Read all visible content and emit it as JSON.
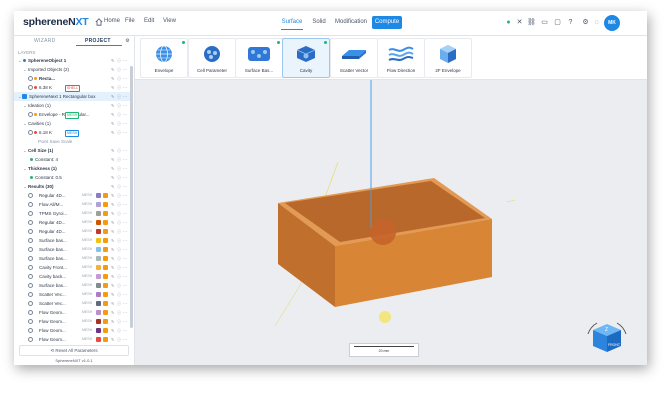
{
  "app": {
    "logo_main": "sphereneN",
    "logo_accent": "XT",
    "menu": [
      "Home",
      "File",
      "Edit",
      "View"
    ],
    "tabs": [
      "Surface",
      "Solid",
      "Modification",
      "Compute"
    ],
    "active_tab": "Compute",
    "avatar": "MK"
  },
  "sidebar": {
    "tabs": [
      "WIZARD",
      "PROJECT"
    ],
    "layers_label": "LAYERS",
    "rows": [
      {
        "indent": 0,
        "label": "SphereneObject 1",
        "color": "#2a7de1",
        "kind": "group",
        "bold": true
      },
      {
        "indent": 1,
        "label": "Imported Objects (2)",
        "kind": "group"
      },
      {
        "indent": 2,
        "label": "Recta...",
        "swatch": "#f39c12",
        "badge": "",
        "bold": true
      },
      {
        "indent": 2,
        "label": "6.38 K",
        "swatch": "#e74c3c",
        "badge": "SHELL",
        "badge_color": "#e74c3c"
      },
      {
        "indent": 0,
        "label": "SphereneNext 1 Rectangular box",
        "kind": "root",
        "highlight": true
      },
      {
        "indent": 1,
        "label": "Ideation (1)",
        "kind": "group"
      },
      {
        "indent": 2,
        "label": "Envelope - Rectangular...",
        "swatch": "#f39c12",
        "badge": "MESH",
        "badge_color": "#22b573"
      },
      {
        "indent": 1,
        "label": "Cavities (1)",
        "kind": "group"
      },
      {
        "indent": 2,
        "label": "6.18 K",
        "swatch": "#e74c3c",
        "badge": "MESH",
        "badge_color": "#1e88e5"
      },
      {
        "indent": 3,
        "label": "Point Save    Scale",
        "kind": "sub"
      },
      {
        "indent": 1,
        "label": "Cell Size (1)",
        "kind": "group",
        "bold": true
      },
      {
        "indent": 2,
        "label": "Constant: 4",
        "kind": "leaf"
      },
      {
        "indent": 1,
        "label": "Thickness (1)",
        "kind": "group",
        "bold": true
      },
      {
        "indent": 2,
        "label": "Constant: 0.5",
        "kind": "leaf"
      },
      {
        "indent": 1,
        "label": "Results (30)",
        "kind": "group",
        "bold": true
      },
      {
        "indent": 2,
        "label": "Regular 4D...",
        "swatch": "#8e7cc3"
      },
      {
        "indent": 2,
        "label": "Flow All/M...",
        "swatch": "#b39ddb"
      },
      {
        "indent": 2,
        "label": "TPMS Gyroi...",
        "swatch": "#9e9e9e"
      },
      {
        "indent": 2,
        "label": "Regular 4D...",
        "swatch": "#d35400"
      },
      {
        "indent": 2,
        "label": "Regular 4D...",
        "swatch": "#c0392b"
      },
      {
        "indent": 2,
        "label": "Surface bas...",
        "swatch": "#f1c40f"
      },
      {
        "indent": 2,
        "label": "Surface bas...",
        "swatch": "#85c1e9"
      },
      {
        "indent": 2,
        "label": "Surface bas...",
        "swatch": "#aab7b8"
      },
      {
        "indent": 2,
        "label": "Cavity Front...",
        "swatch": "#f5b041"
      },
      {
        "indent": 2,
        "label": "Cavity back...",
        "swatch": "#c39bd3"
      },
      {
        "indent": 2,
        "label": "Surface bas...",
        "swatch": "#7f8c8d"
      },
      {
        "indent": 2,
        "label": "Scatter Vec...",
        "swatch": "#af7ac5"
      },
      {
        "indent": 2,
        "label": "Scatter Vec...",
        "swatch": "#5d6d7e"
      },
      {
        "indent": 2,
        "label": "Flow Geom...",
        "swatch": "#bb8fce"
      },
      {
        "indent": 2,
        "label": "Flow Geom...",
        "swatch": "#a93226"
      },
      {
        "indent": 2,
        "label": "Flow Geom...",
        "swatch": "#6c3483"
      },
      {
        "indent": 2,
        "label": "Flow Geom...",
        "swatch": "#e74c3c"
      }
    ],
    "reset_label": "Reset All Parameters",
    "version": "SphereneNXT v1.0.1"
  },
  "ribbon": {
    "tools": [
      {
        "label": "Envelope",
        "icon": "sphere-grid-icon",
        "new": true
      },
      {
        "label": "Cell Parameter",
        "icon": "cell-parameter-icon",
        "new": false
      },
      {
        "label": "Surface Bas...",
        "icon": "surface-based-icon",
        "new": true
      },
      {
        "label": "Cavity",
        "icon": "cavity-icon",
        "new": true,
        "selected": true
      },
      {
        "label": "Scatter Vector",
        "icon": "scatter-vector-icon",
        "new": false
      },
      {
        "label": "Flow Direction",
        "icon": "flow-direction-icon",
        "new": false
      },
      {
        "label": "2F Envelope",
        "icon": "envelope-cube-icon",
        "new": false
      }
    ]
  },
  "viewport": {
    "scale_label": "20 mm",
    "nav_cube_front": "FRONT",
    "nav_cube_top": "Z",
    "box_color": "#d07a2a"
  }
}
